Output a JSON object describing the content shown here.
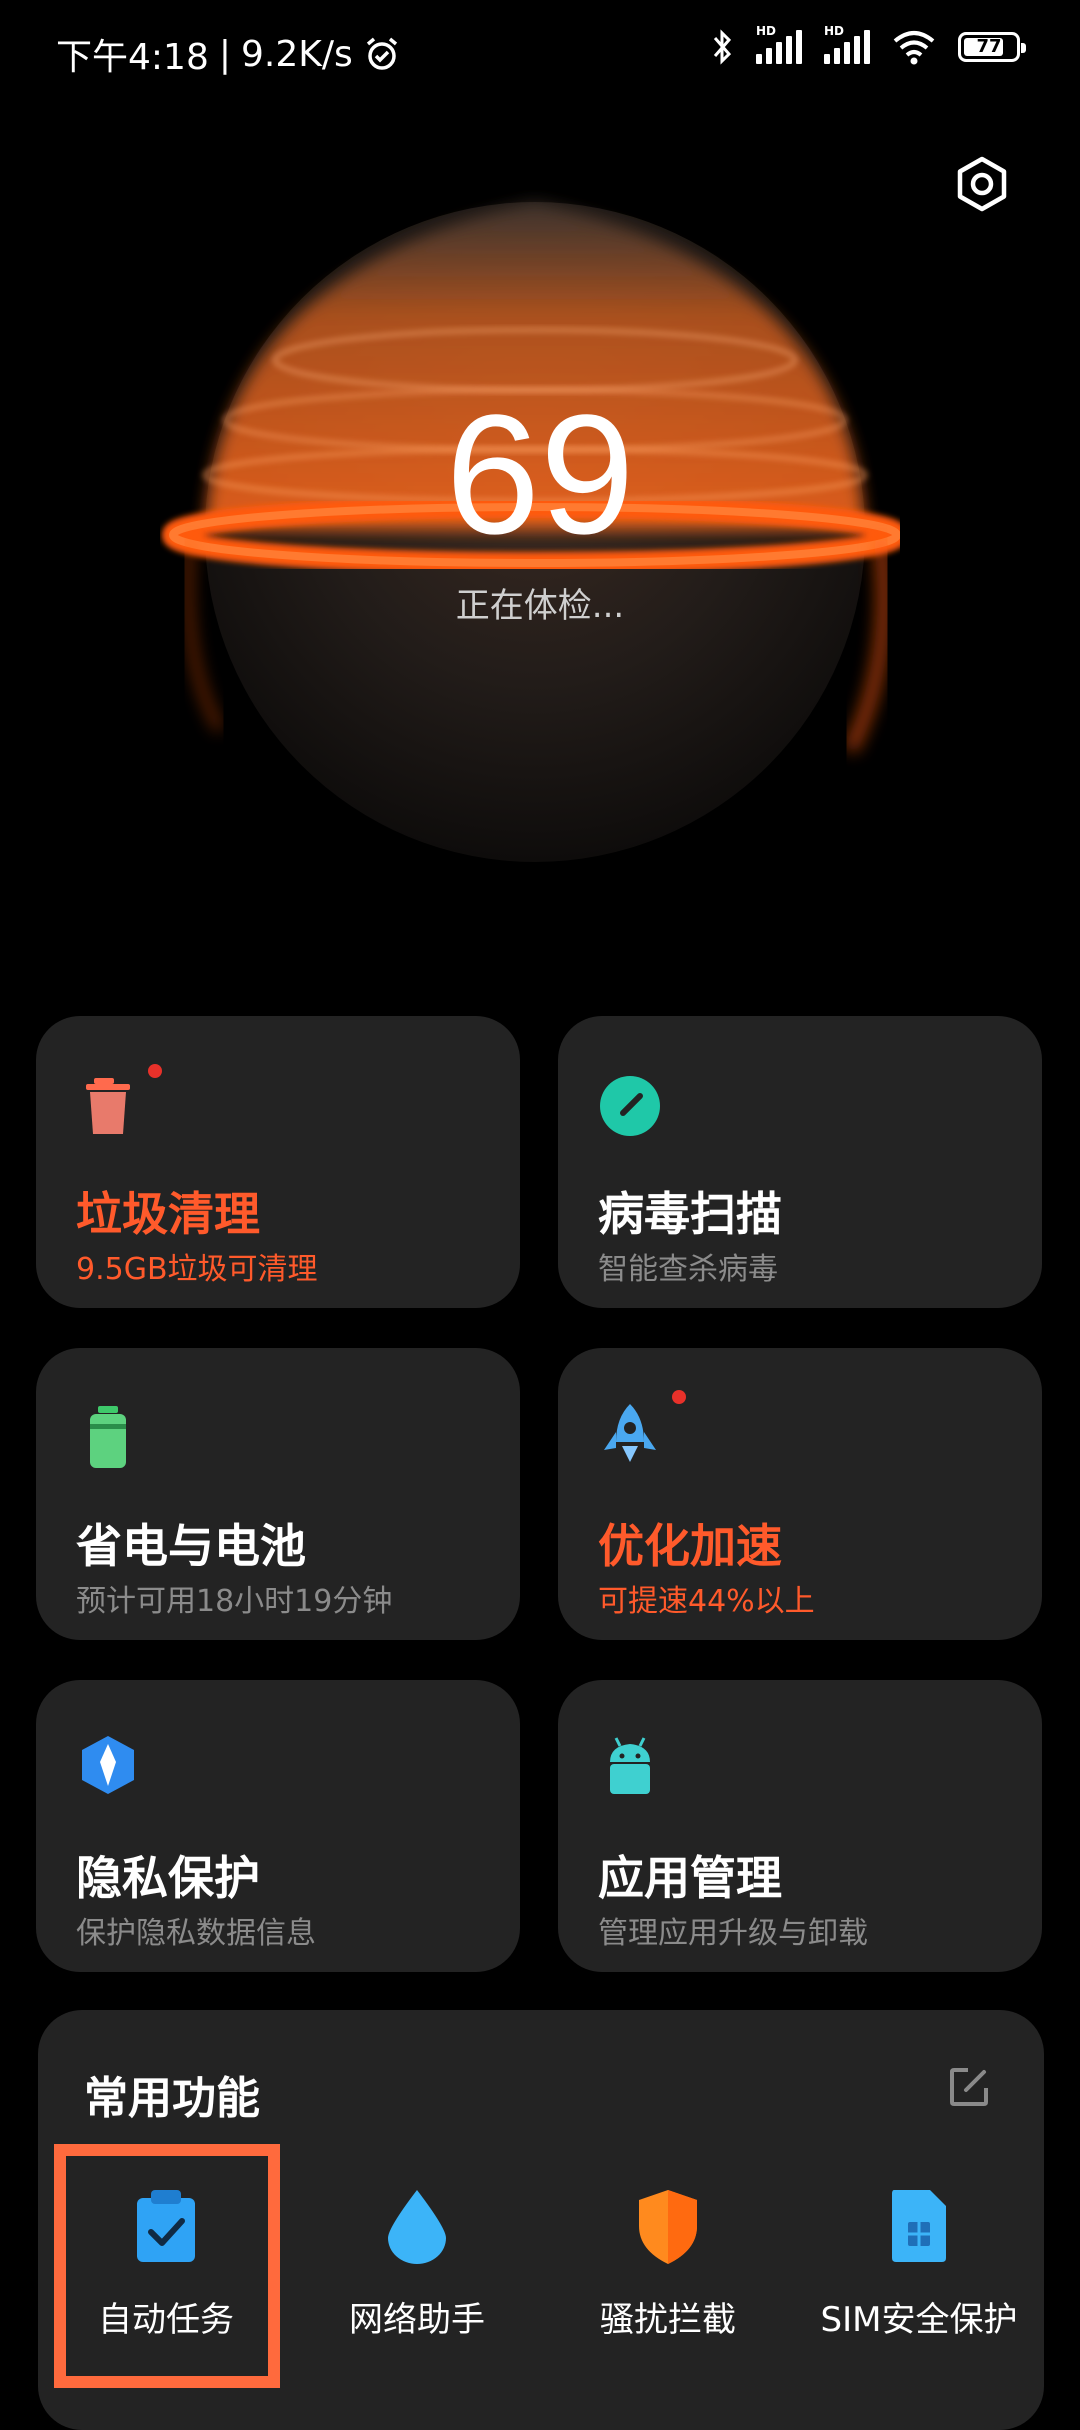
{
  "status_bar": {
    "time": "下午4:18",
    "net_speed": "9.2K/s",
    "battery": "77"
  },
  "score": {
    "value": "69",
    "status": "正在体检..."
  },
  "cards": [
    {
      "title": "垃圾清理",
      "subtitle": "9.5GB垃圾可清理",
      "icon": "trash-icon",
      "alert": true
    },
    {
      "title": "病毒扫描",
      "subtitle": "智能查杀病毒",
      "icon": "virus-scan-icon",
      "alert": false
    },
    {
      "title": "省电与电池",
      "subtitle": "预计可用18小时19分钟",
      "icon": "battery-icon",
      "alert": false
    },
    {
      "title": "优化加速",
      "subtitle": "可提速44%以上",
      "icon": "rocket-icon",
      "alert": true
    },
    {
      "title": "隐私保护",
      "subtitle": "保护隐私数据信息",
      "icon": "privacy-icon",
      "alert": false
    },
    {
      "title": "应用管理",
      "subtitle": "管理应用升级与卸载",
      "icon": "android-icon",
      "alert": false
    }
  ],
  "common": {
    "title": "常用功能",
    "items": [
      {
        "label": "自动任务",
        "icon": "clipboard-check-icon"
      },
      {
        "label": "网络助手",
        "icon": "water-drop-icon"
      },
      {
        "label": "骚扰拦截",
        "icon": "shield-icon"
      },
      {
        "label": "SIM安全保护",
        "icon": "sim-card-icon"
      }
    ]
  },
  "colors": {
    "accent": "#ff5a2b",
    "card_bg": "#232323",
    "highlight": "#ff6a3d"
  }
}
